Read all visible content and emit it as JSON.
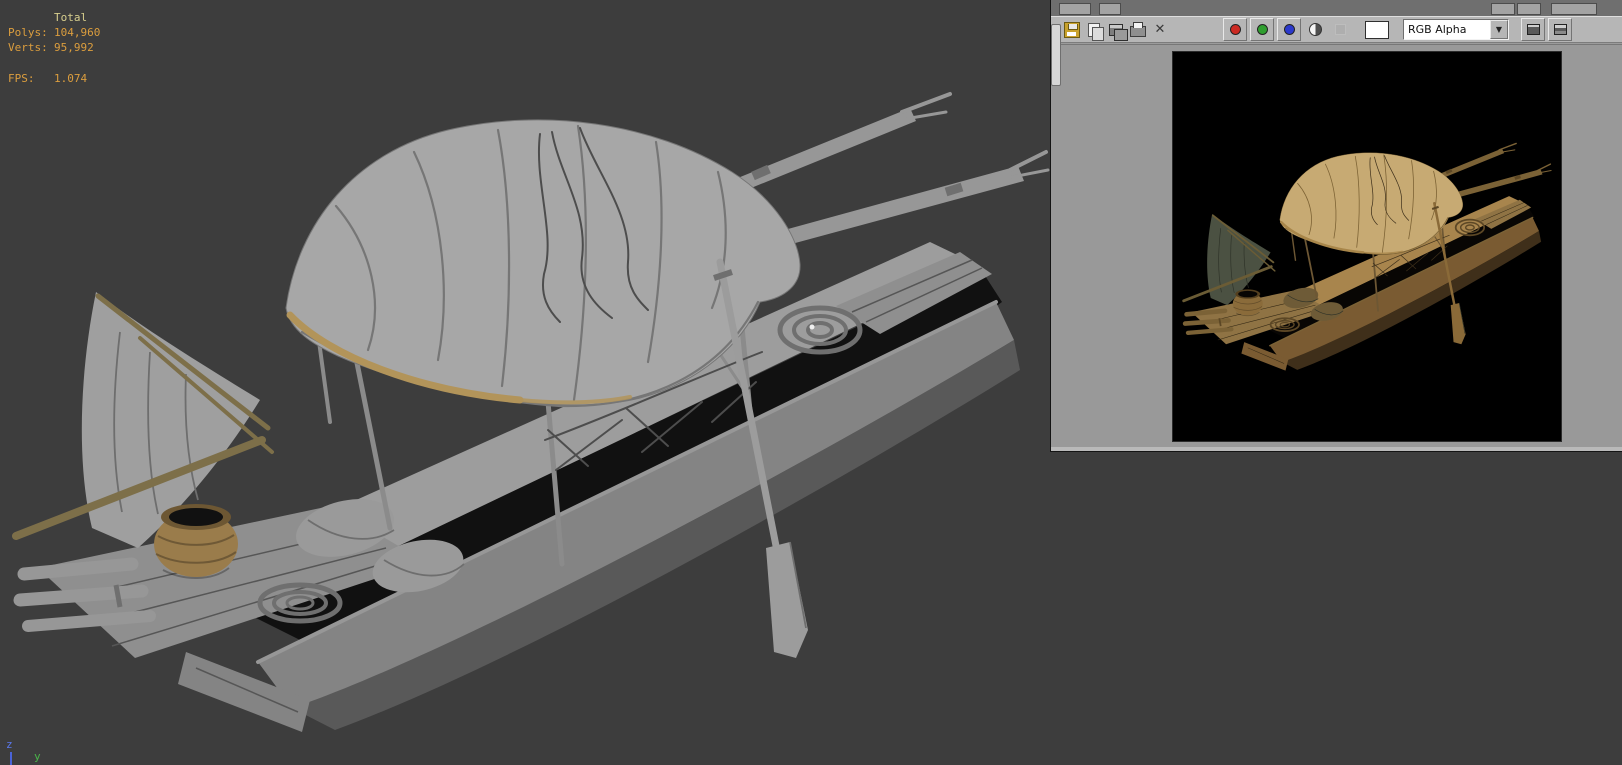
{
  "viewport": {
    "background_color": "#3d3d3d",
    "stats": {
      "total_label": "Total",
      "rows": [
        {
          "label": "Polys:",
          "value": "104,960"
        },
        {
          "label": "Verts:",
          "value": "95,992"
        }
      ],
      "fps_label": "FPS:",
      "fps_value": "1.074",
      "total_color": "#d8cf8e",
      "text_color": "#dc9e3e"
    },
    "axis_gizmo": {
      "z": "z",
      "y": "y",
      "z_color": "#5b79f0",
      "y_color": "#49b649"
    },
    "content": "gray clay model of wooden covered boat with sail, oar, basket and rope coils"
  },
  "render_window": {
    "toolbar": {
      "icons": [
        "save-bitmap",
        "copy-bitmap",
        "clone-rendered-frame",
        "print",
        "clear"
      ],
      "clear_glyph": "✕",
      "channels": [
        {
          "name": "red",
          "color": "#cc2a22"
        },
        {
          "name": "green",
          "color": "#2f9e2f"
        },
        {
          "name": "blue",
          "color": "#2b39cc"
        }
      ],
      "monochrome_name": "monochrome",
      "alpha_name": "alpha-channel",
      "swatch_color": "#ffffff",
      "channel_display": {
        "value": "RGB Alpha",
        "arrow": "▼"
      }
    },
    "render_background": "#000000",
    "content": "textured render of the same wooden boat on black background"
  }
}
